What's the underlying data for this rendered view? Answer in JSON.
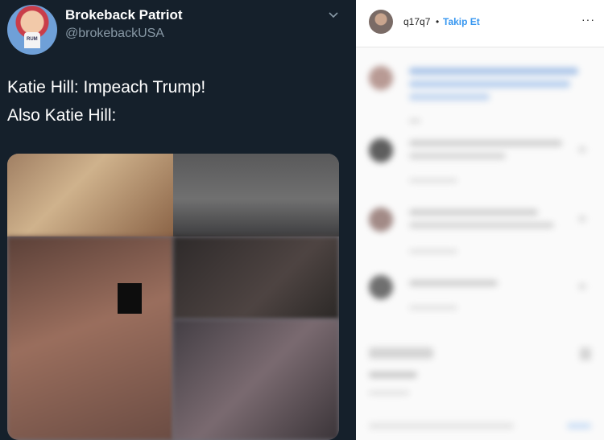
{
  "tweet": {
    "display_name": "Brokeback Patriot",
    "handle": "@brokebackUSA",
    "text_line_1": "Katie Hill: Impeach Trump!",
    "text_line_2": "Also Katie Hill:",
    "avatar_shirt_text": "RUM"
  },
  "instagram": {
    "username": "q17q7",
    "separator": "•",
    "follow_label": "Takip Et",
    "more_label": "···"
  },
  "colors": {
    "tweet_bg": "#15202b",
    "tweet_handle": "#8899a6",
    "ig_follow": "#3897f0"
  }
}
